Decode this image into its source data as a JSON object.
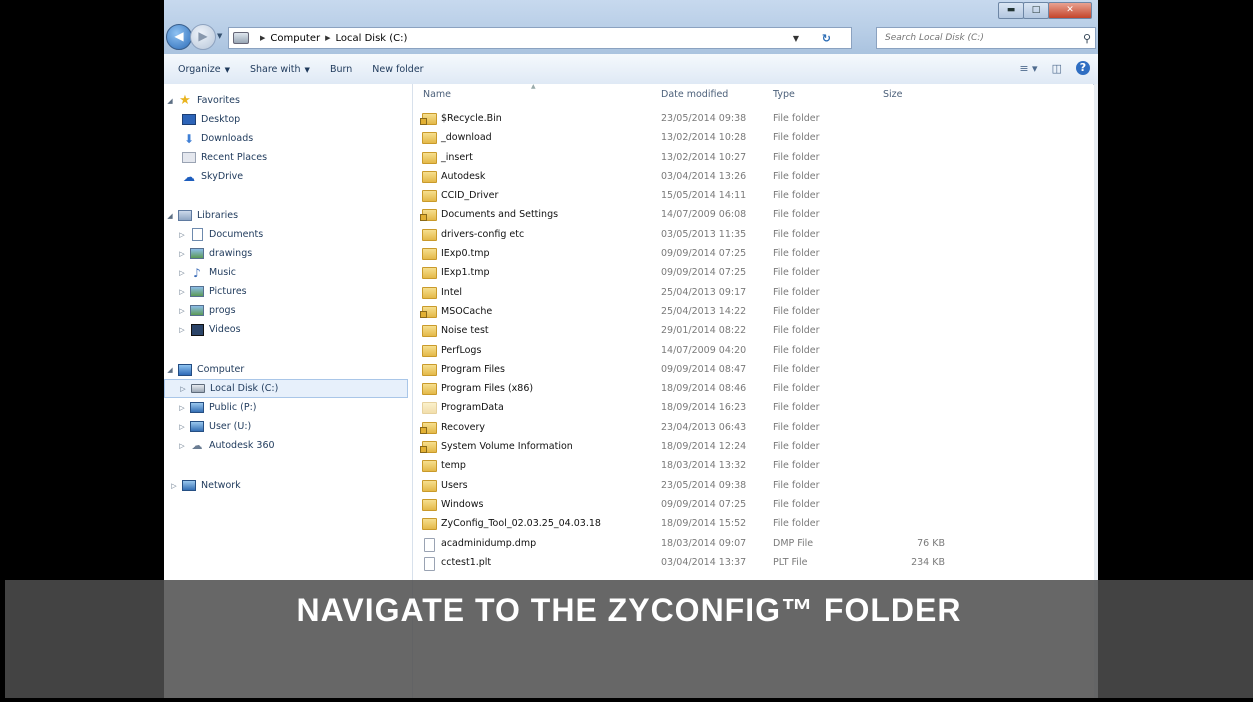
{
  "address": {
    "crumbs": [
      "Computer",
      "Local Disk (C:)"
    ],
    "search_placeholder": "Search Local Disk (C:)"
  },
  "toolbar": {
    "organize": "Organize",
    "share_with": "Share with",
    "burn": "Burn",
    "new_folder": "New folder"
  },
  "nav": {
    "favorites": {
      "label": "Favorites",
      "items": [
        "Desktop",
        "Downloads",
        "Recent Places",
        "SkyDrive"
      ]
    },
    "libraries": {
      "label": "Libraries",
      "items": [
        "Documents",
        "drawings",
        "Music",
        "Pictures",
        "progs",
        "Videos"
      ]
    },
    "computer": {
      "label": "Computer",
      "items": [
        "Local Disk (C:)",
        "Public (P:)",
        "User (U:)",
        "Autodesk 360"
      ]
    },
    "network": "Network"
  },
  "columns": {
    "name": "Name",
    "date": "Date modified",
    "type": "Type",
    "size": "Size"
  },
  "files": [
    {
      "name": "$Recycle.Bin",
      "date": "23/05/2014 09:38",
      "type": "File folder",
      "size": ""
    },
    {
      "name": "_download",
      "date": "13/02/2014 10:28",
      "type": "File folder",
      "size": ""
    },
    {
      "name": "_insert",
      "date": "13/02/2014 10:27",
      "type": "File folder",
      "size": ""
    },
    {
      "name": "Autodesk",
      "date": "03/04/2014 13:26",
      "type": "File folder",
      "size": ""
    },
    {
      "name": "CCID_Driver",
      "date": "15/05/2014 14:11",
      "type": "File folder",
      "size": ""
    },
    {
      "name": "Documents and Settings",
      "date": "14/07/2009 06:08",
      "type": "File folder",
      "size": ""
    },
    {
      "name": "drivers-config etc",
      "date": "03/05/2013 11:35",
      "type": "File folder",
      "size": ""
    },
    {
      "name": "IExp0.tmp",
      "date": "09/09/2014 07:25",
      "type": "File folder",
      "size": ""
    },
    {
      "name": "IExp1.tmp",
      "date": "09/09/2014 07:25",
      "type": "File folder",
      "size": ""
    },
    {
      "name": "Intel",
      "date": "25/04/2013 09:17",
      "type": "File folder",
      "size": ""
    },
    {
      "name": "MSOCache",
      "date": "25/04/2013 14:22",
      "type": "File folder",
      "size": ""
    },
    {
      "name": "Noise test",
      "date": "29/01/2014 08:22",
      "type": "File folder",
      "size": ""
    },
    {
      "name": "PerfLogs",
      "date": "14/07/2009 04:20",
      "type": "File folder",
      "size": ""
    },
    {
      "name": "Program Files",
      "date": "09/09/2014 08:47",
      "type": "File folder",
      "size": ""
    },
    {
      "name": "Program Files (x86)",
      "date": "18/09/2014 08:46",
      "type": "File folder",
      "size": ""
    },
    {
      "name": "ProgramData",
      "date": "18/09/2014 16:23",
      "type": "File folder",
      "size": ""
    },
    {
      "name": "Recovery",
      "date": "23/04/2013 06:43",
      "type": "File folder",
      "size": ""
    },
    {
      "name": "System Volume Information",
      "date": "18/09/2014 12:24",
      "type": "File folder",
      "size": ""
    },
    {
      "name": "temp",
      "date": "18/03/2014 13:32",
      "type": "File folder",
      "size": ""
    },
    {
      "name": "Users",
      "date": "23/05/2014 09:38",
      "type": "File folder",
      "size": ""
    },
    {
      "name": "Windows",
      "date": "09/09/2014 07:25",
      "type": "File folder",
      "size": ""
    },
    {
      "name": "ZyConfig_Tool_02.03.25_04.03.18",
      "date": "18/09/2014 15:52",
      "type": "File folder",
      "size": ""
    },
    {
      "name": "acadminidump.dmp",
      "date": "18/03/2014 09:07",
      "type": "DMP File",
      "size": "76 KB"
    },
    {
      "name": "cctest1.plt",
      "date": "03/04/2014 13:37",
      "type": "PLT File",
      "size": "234 KB"
    }
  ],
  "caption": "NAVIGATE TO THE ZYCONFIG™ FOLDER"
}
